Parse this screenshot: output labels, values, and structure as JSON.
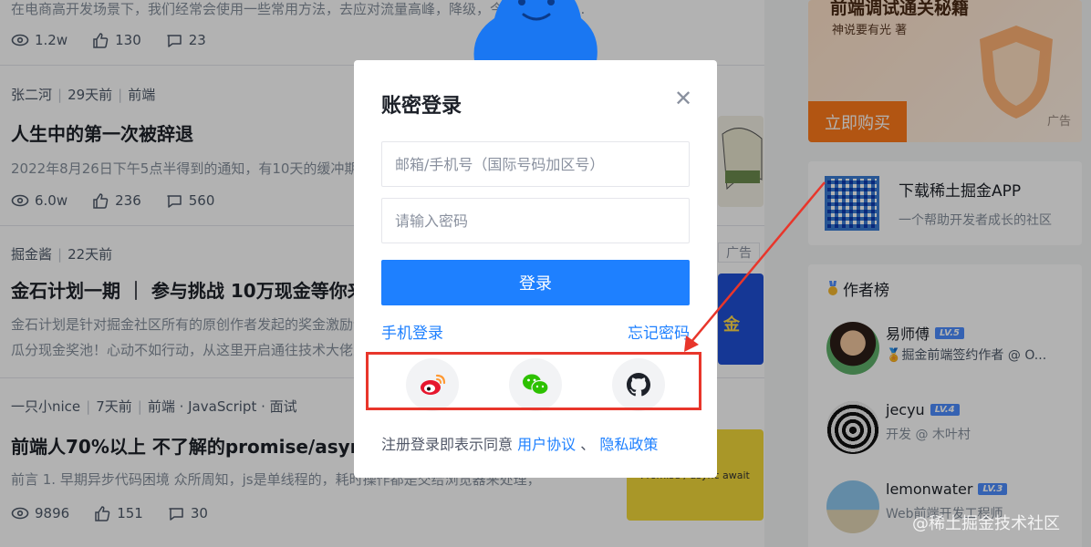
{
  "feed": {
    "top_article": {
      "summary": "在电商高开发场景下，我们经常会使用一些常用方法，去应对流量高峰，降级，今天我们聊聊...",
      "views": "1.2w",
      "likes": "130",
      "comments": "23"
    },
    "articles": [
      {
        "author": "张二河",
        "time": "29天前",
        "tags": "前端",
        "title": "人生中的第一次被辞退",
        "summary": "2022年8月26日下午5点半得到的通知，有10天的缓冲期...",
        "views": "6.0w",
        "likes": "236",
        "comments": "560"
      },
      {
        "author": "掘金酱",
        "time": "22天前",
        "tags": "",
        "ad": "广告",
        "title": "金石计划一期 ｜ 参与挑战 10万现金等你来拿",
        "summary": "金石计划是针对掘金社区所有的原创作者发起的奖金激励计划",
        "summary2": "瓜分现金奖池！心动不如行动，从这里开启通往技术大佬之路"
      },
      {
        "author": "一只小nice",
        "time": "7天前",
        "tags": "前端 · JavaScript · 面试",
        "title": "前端人70%以上 不了解的promise/async await",
        "summary": "前言 1. 早期异步代码困境 众所周知，js是单线程的，耗时操作都是交给浏览器来处理，",
        "views": "9896",
        "likes": "151",
        "comments": "30",
        "thumb_text": "Promise / async await"
      }
    ]
  },
  "sidebar": {
    "promo": {
      "title": "前端调试通关秘籍",
      "author": "神说要有光 著",
      "button": "立即购买",
      "ad": "广告"
    },
    "app": {
      "title": "下载稀土掘金APP",
      "subtitle": "一个帮助开发者成长的社区"
    },
    "authors": {
      "heading": "作者榜",
      "items": [
        {
          "name": "易师傅",
          "level": "LV.5",
          "desc": "掘金前端签约作者 @ O..."
        },
        {
          "name": "jecyu",
          "level": "LV.4",
          "desc": "开发 @ 木叶村"
        },
        {
          "name": "lemonwater",
          "level": "LV.3",
          "desc": "Web前端开发工程师"
        }
      ]
    }
  },
  "modal": {
    "title": "账密登录",
    "account_placeholder": "邮箱/手机号（国际号码加区号）",
    "password_placeholder": "请输入密码",
    "login_button": "登录",
    "phone_login": "手机登录",
    "forgot_password": "忘记密码",
    "agreement_prefix": "注册登录即表示同意",
    "user_agreement": "用户协议",
    "separator": "、",
    "privacy_policy": "隐私政策",
    "social": [
      "weibo-icon",
      "wechat-icon",
      "github-icon"
    ]
  },
  "watermark": "@稀土掘金技术社区",
  "colors": {
    "accent": "#1e80ff",
    "highlight": "#e8362b",
    "promo": "#ff7a1a"
  }
}
